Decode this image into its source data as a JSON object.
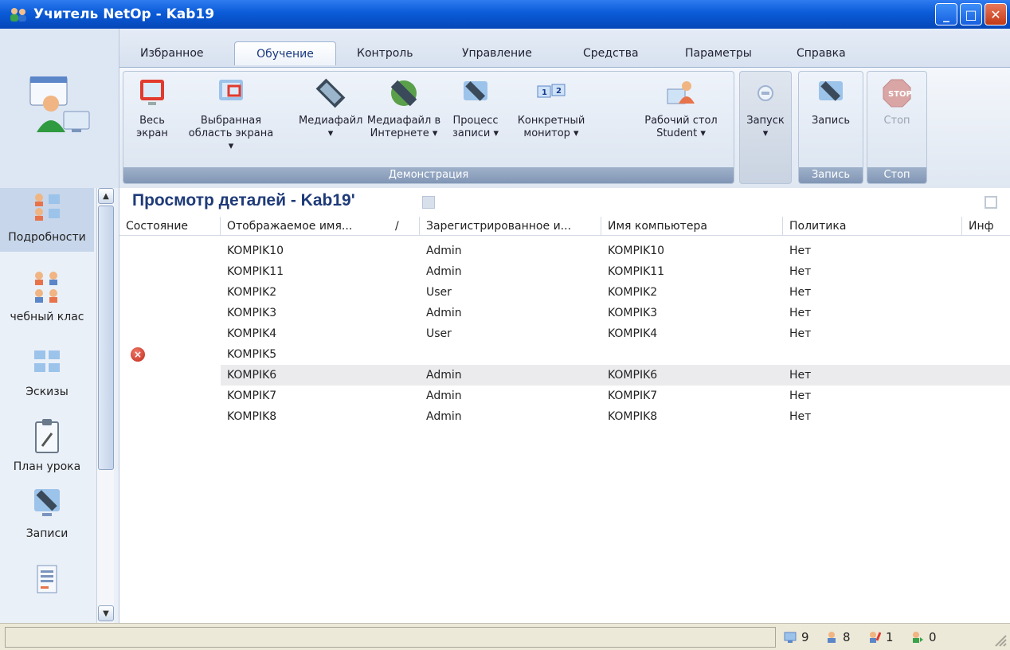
{
  "window": {
    "title": "Учитель NetOp - Kab19",
    "minimize": "_",
    "maximize": "□",
    "close": "✕"
  },
  "tabs": [
    "Избранное",
    "Обучение",
    "Контроль",
    "Управление",
    "Средства",
    "Параметры",
    "Справка"
  ],
  "ribbon": {
    "demo_group": "Демонстрация",
    "record_group": "Запись",
    "stop_group": "Стоп",
    "buttons": {
      "full_screen": [
        "Весь",
        "экран"
      ],
      "selected_area": [
        "Выбранная",
        "область экрана ▾"
      ],
      "media_file": [
        "Медиафайл",
        "▾"
      ],
      "media_internet": [
        "Медиафайл в",
        "Интернете ▾"
      ],
      "process": [
        "Процесс",
        "записи ▾"
      ],
      "monitor": [
        "Конкретный",
        "монитор ▾"
      ],
      "desktop": [
        "Рабочий стол",
        "Student ▾"
      ],
      "launch": [
        "Запуск",
        "▾"
      ],
      "record": [
        "Запись",
        ""
      ],
      "stop": [
        "Стоп",
        ""
      ]
    }
  },
  "leftnav": {
    "items": [
      {
        "label": "Подробности"
      },
      {
        "label": "чебный клас"
      },
      {
        "label": "Эскизы"
      },
      {
        "label": "План урока"
      },
      {
        "label": "Записи"
      }
    ]
  },
  "view": {
    "title": "Просмотр деталей - Kab19'"
  },
  "grid": {
    "columns": [
      "Состояние",
      "Отображаемое имя...",
      "/",
      "Зарегистрированное и...",
      "Имя компьютера",
      "Политика",
      "Инф"
    ],
    "rows": [
      {
        "status": "",
        "display": "KOMPIK10",
        "registered": "Admin",
        "computer": "KOMPIK10",
        "policy": "Нет"
      },
      {
        "status": "",
        "display": "KOMPIK11",
        "registered": "Admin",
        "computer": "KOMPIK11",
        "policy": "Нет"
      },
      {
        "status": "",
        "display": "KOMPIK2",
        "registered": "User",
        "computer": "KOMPIK2",
        "policy": "Нет"
      },
      {
        "status": "",
        "display": "KOMPIK3",
        "registered": "Admin",
        "computer": "KOMPIK3",
        "policy": "Нет"
      },
      {
        "status": "",
        "display": "KOMPIK4",
        "registered": "User",
        "computer": "KOMPIK4",
        "policy": "Нет"
      },
      {
        "status": "error",
        "display": "KOMPIK5",
        "registered": "",
        "computer": "",
        "policy": ""
      },
      {
        "status": "",
        "display": "KOMPIK6",
        "registered": "Admin",
        "computer": "KOMPIK6",
        "policy": "Нет"
      },
      {
        "status": "",
        "display": "KOMPIK7",
        "registered": "Admin",
        "computer": "KOMPIK7",
        "policy": "Нет"
      },
      {
        "status": "",
        "display": "KOMPIK8",
        "registered": "Admin",
        "computer": "KOMPIK8",
        "policy": "Нет"
      }
    ]
  },
  "status": {
    "total": "9",
    "connected": "8",
    "hands": "1",
    "other": "0"
  }
}
